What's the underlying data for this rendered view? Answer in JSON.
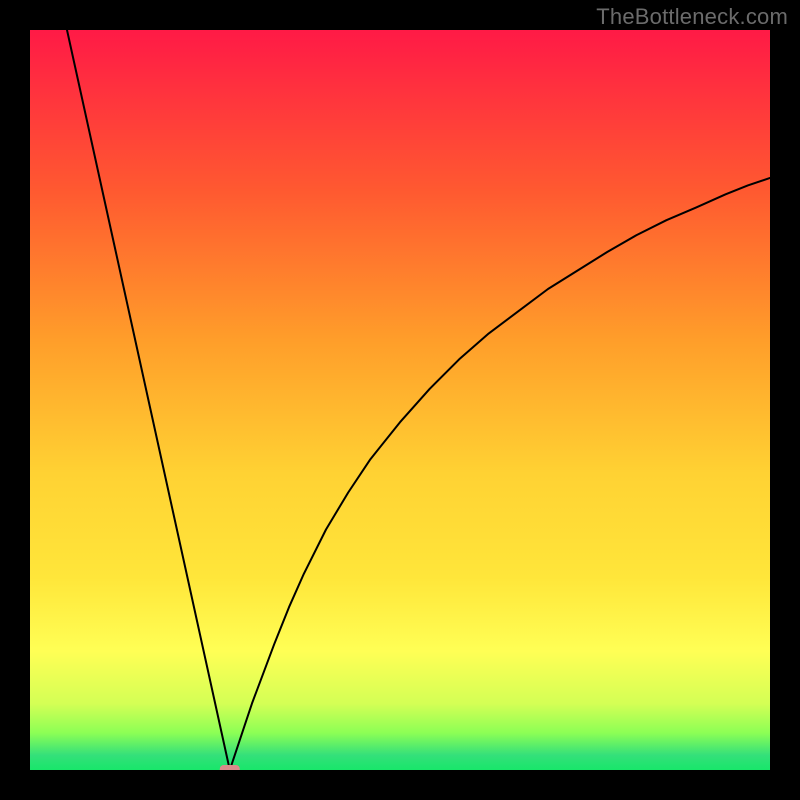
{
  "watermark": "TheBottleneck.com",
  "chart_data": {
    "type": "line",
    "title": "",
    "xlabel": "",
    "ylabel": "",
    "xlim": [
      0,
      100
    ],
    "ylim": [
      0,
      100
    ],
    "grid": false,
    "legend": false,
    "x_minimum": 27,
    "marker": {
      "x": 27,
      "y": 0,
      "color": "#d98b8b"
    },
    "background_gradient_colors_top_to_bottom": [
      "#ff1a46",
      "#ff9e2a",
      "#ffe63a",
      "#ffff55",
      "#9cff55",
      "#34e07a",
      "#18e66a"
    ],
    "curve_color": "#000000",
    "curve_description": "V-shaped curve: linear descent from (5,100) to (27,0); concave-increasing ascent from (27,0) toward (100,~80)",
    "series": [
      {
        "name": "curve",
        "x": [
          5.0,
          6.1,
          7.2,
          8.3,
          9.4,
          10.5,
          11.6,
          12.7,
          13.8,
          14.9,
          16.0,
          17.1,
          18.2,
          19.3,
          20.4,
          21.5,
          22.6,
          23.7,
          24.8,
          25.9,
          27.0,
          28.0,
          29.0,
          30.0,
          31.5,
          33.0,
          35.0,
          37.0,
          40.0,
          43.0,
          46.0,
          50.0,
          54.0,
          58.0,
          62.0,
          66.0,
          70.0,
          74.0,
          78.0,
          82.0,
          86.0,
          90.0,
          94.0,
          97.0,
          100.0
        ],
        "y": [
          100.0,
          95.0,
          90.0,
          85.0,
          80.0,
          75.0,
          70.0,
          65.0,
          60.0,
          55.0,
          50.0,
          45.0,
          40.0,
          35.0,
          30.0,
          25.0,
          20.0,
          15.0,
          10.0,
          5.0,
          0.0,
          3.0,
          6.0,
          9.0,
          13.0,
          17.0,
          22.0,
          26.5,
          32.5,
          37.5,
          42.0,
          47.0,
          51.5,
          55.5,
          59.0,
          62.0,
          65.0,
          67.5,
          70.0,
          72.3,
          74.3,
          76.0,
          77.8,
          79.0,
          80.0
        ]
      }
    ]
  }
}
